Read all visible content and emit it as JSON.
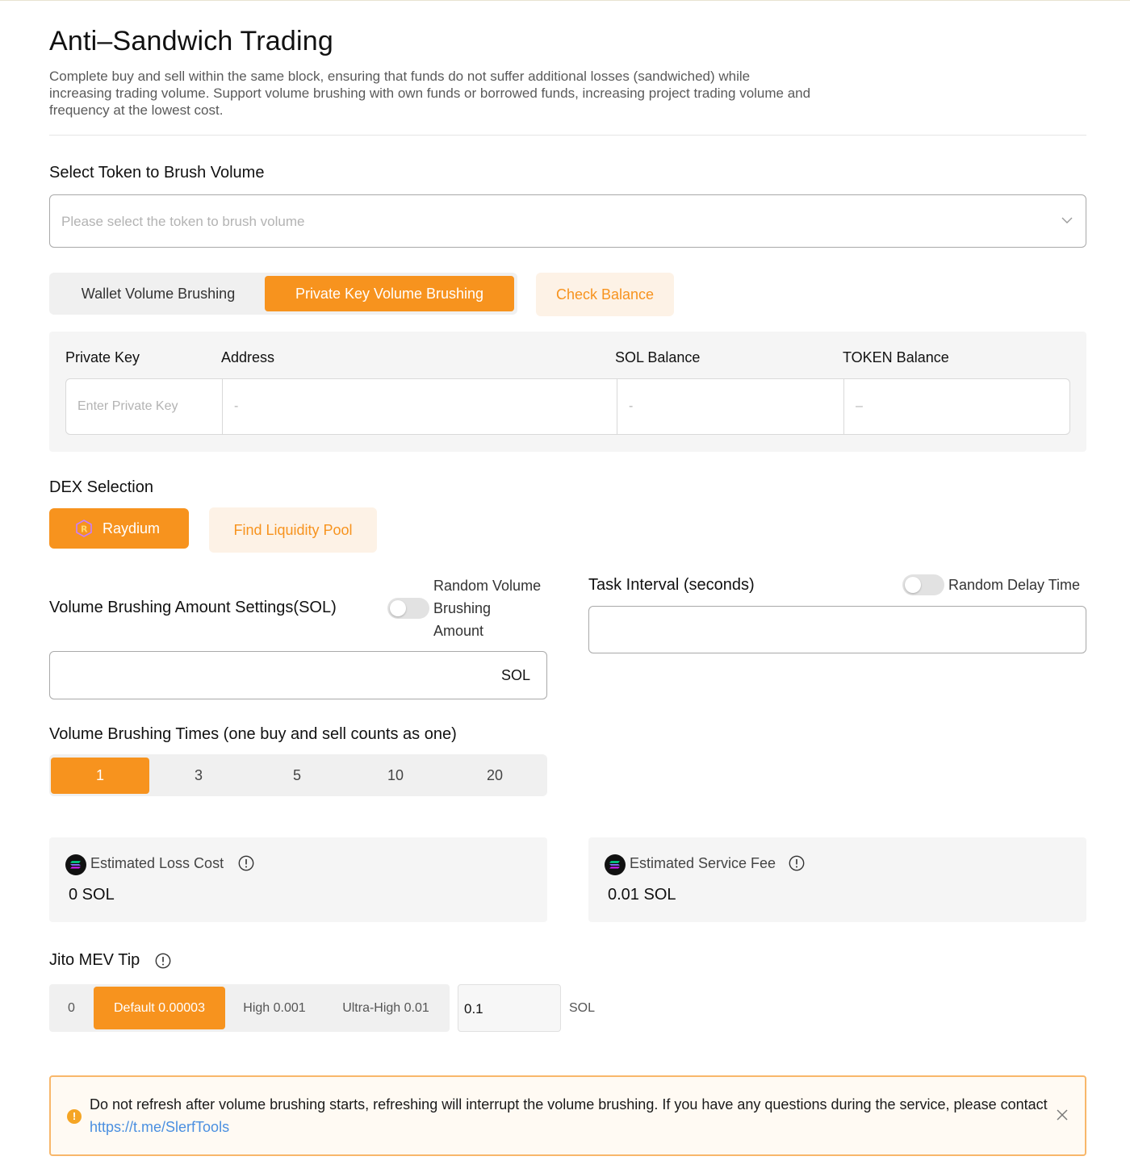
{
  "header": {
    "title": "Anti–Sandwich Trading",
    "description": "Complete buy and sell within the same block, ensuring that funds do not suffer additional losses (sandwiched) while increasing trading volume. Support volume brushing with own funds or borrowed funds, increasing project trading volume and frequency at the lowest cost."
  },
  "token_select": {
    "label": "Select Token to Brush Volume",
    "placeholder": "Please select the token to brush volume"
  },
  "mode_tabs": [
    {
      "label": "Wallet Volume Brushing",
      "active": false
    },
    {
      "label": "Private Key Volume Brushing",
      "active": true
    }
  ],
  "check_balance_label": "Check Balance",
  "key_table": {
    "headers": [
      "Private Key",
      "Address",
      "SOL Balance",
      "TOKEN Balance"
    ],
    "private_key_placeholder": "Enter Private Key",
    "address": "-",
    "sol_balance": "-",
    "token_balance": "–"
  },
  "dex": {
    "label": "DEX Selection",
    "selected": "Raydium",
    "find_pool_label": "Find Liquidity Pool"
  },
  "amount": {
    "label": "Volume Brushing Amount Settings(SOL)",
    "toggle_label_line1": "Random Volume",
    "toggle_label_line2": "Brushing",
    "toggle_label_line3": "Amount",
    "toggle_on": false,
    "unit": "SOL",
    "value": ""
  },
  "interval": {
    "label": "Task Interval (seconds)",
    "toggle_label": "Random Delay Time",
    "toggle_on": false,
    "value": ""
  },
  "times": {
    "label": "Volume Brushing Times (one buy and sell counts as one)",
    "options": [
      "1",
      "3",
      "5",
      "10",
      "20"
    ],
    "selected": "1"
  },
  "loss_cost": {
    "label": "Estimated Loss Cost",
    "value": "0 SOL"
  },
  "service_fee": {
    "label": "Estimated Service Fee",
    "value": "0.01 SOL"
  },
  "jito": {
    "label": "Jito MEV Tip",
    "options": [
      "0",
      "Default 0.00003",
      "High 0.001",
      "Ultra-High 0.01"
    ],
    "selected": "Default 0.00003",
    "custom_value": "0.1",
    "unit": "SOL"
  },
  "alert": {
    "message": "Do not refresh after volume brushing starts, refreshing will interrupt the volume brushing. If you have any questions during the service, please contact ",
    "link": "https://t.me/SlerfTools"
  },
  "colors": {
    "accent": "#f7931e",
    "accent_soft": "#fdf2e6",
    "panel": "#f5f5f5",
    "link": "#4a8fe0"
  }
}
